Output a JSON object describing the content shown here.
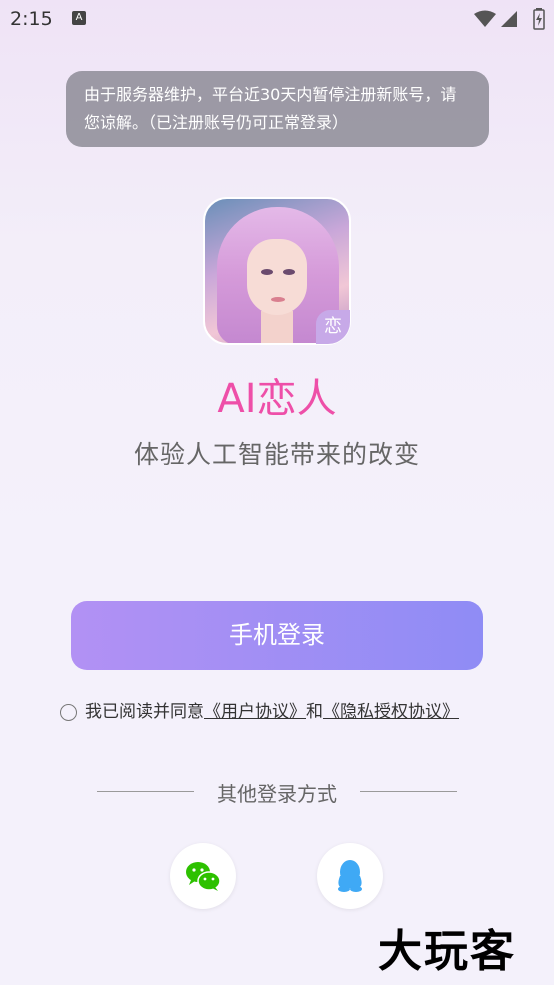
{
  "status_bar": {
    "time": "2:15",
    "notification_icon": "A"
  },
  "notice": {
    "text": "由于服务器维护，平台近30天内暂停注册新账号，请您谅解。（已注册账号仍可正常登录）"
  },
  "app": {
    "badge": "恋",
    "title": "AI恋人",
    "subtitle": "体验人工智能带来的改变"
  },
  "login": {
    "phone_button": "手机登录"
  },
  "agreement": {
    "prefix": "我已阅读并同意",
    "user_agreement": "《用户协议》",
    "conjunction": "和",
    "privacy_agreement": "《隐私授权协议》"
  },
  "other_login": {
    "label": "其他登录方式",
    "providers": [
      "wechat-icon",
      "qq-icon"
    ]
  },
  "watermark": {
    "text": "大玩客"
  },
  "colors": {
    "title": "#ee4fa8",
    "button_start": "#b291f4",
    "button_end": "#8f8cf5",
    "wechat": "#2dc100",
    "qq": "#3fa9f5"
  }
}
